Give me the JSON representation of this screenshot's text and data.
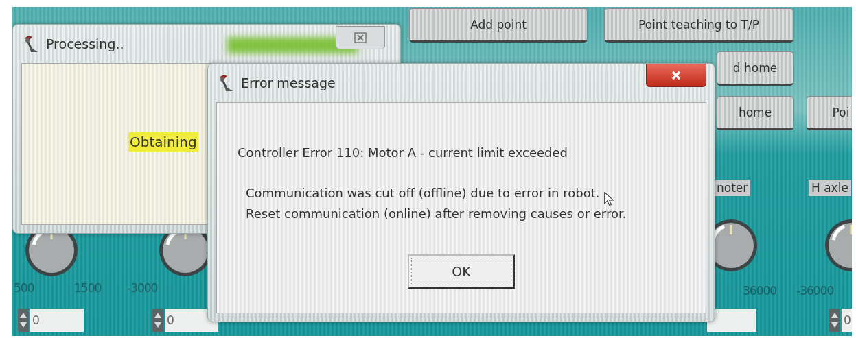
{
  "control_panel": {
    "buttons": [
      {
        "label": "Add point"
      },
      {
        "label": "Point teaching to T/P"
      },
      {
        "label": "d home"
      },
      {
        "label": "home"
      },
      {
        "label": "Poi"
      }
    ],
    "axis_labels": [
      {
        "label": "noter"
      },
      {
        "label": "H axle"
      }
    ],
    "scale_labels": [
      "500",
      "1500",
      "-3000",
      "36000",
      "-36000"
    ],
    "fields": [
      {
        "kind": "spin",
        "value": "0"
      },
      {
        "kind": "spin",
        "value": "0"
      },
      {
        "kind": "plain"
      },
      {
        "kind": "spin",
        "value": "0"
      }
    ]
  },
  "processing_window": {
    "title": "Processing..",
    "status": "Obtaining"
  },
  "error_dialog": {
    "title": "Error message",
    "message": "Controller Error 110: Motor A - current limit exceeded",
    "details": [
      "Communication was cut off (offline) due to error in robot.",
      "Reset communication (online) after removing causes or error."
    ],
    "button": "OK"
  }
}
